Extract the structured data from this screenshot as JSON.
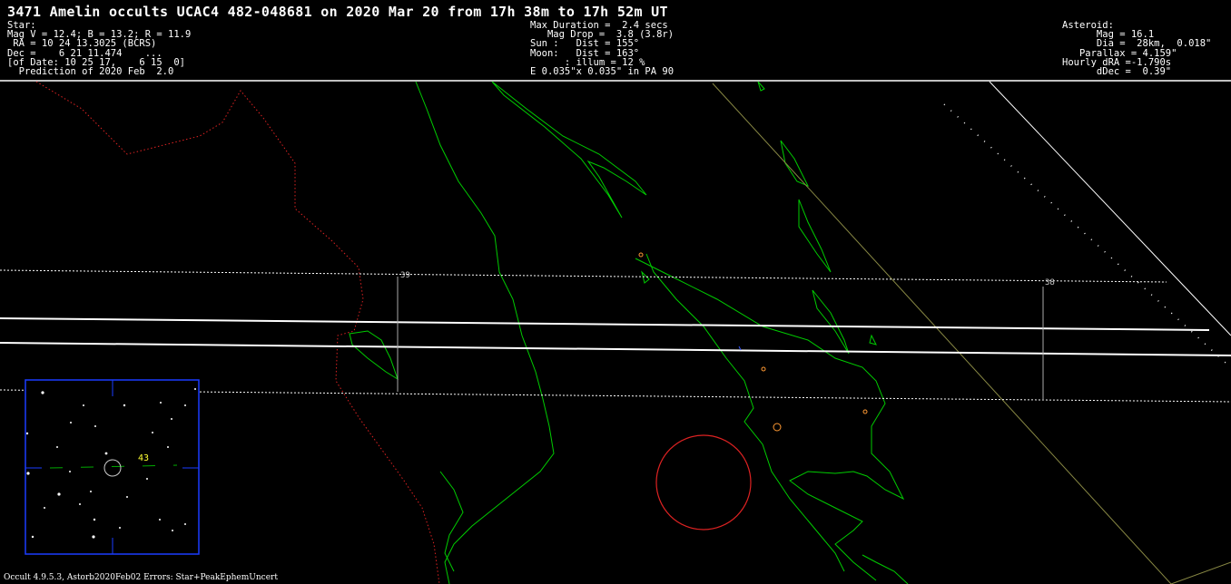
{
  "title": "3471 Amelin occults UCAC4 482-048681 on 2020 Mar 20 from 17h 38m to 17h 52m UT",
  "star_block": {
    "lines": [
      "Star:",
      "Mag V = 12.4; B = 13.2; R = 11.9",
      " RA = 10 24 13.3025 (BCRS)",
      "Dec =    6 21 11.474    ...",
      "[of Date: 10 25 17,    6 15  0]",
      "  Prediction of 2020 Feb  2.0"
    ]
  },
  "event_block": {
    "lines": [
      "Max Duration =  2.4 secs",
      "   Mag Drop =  3.8 (3.8r)",
      "Sun :   Dist = 155°",
      "Moon:   Dist = 163°",
      "      : illum = 12 %",
      "E 0.035\"x 0.035\" in PA 90"
    ]
  },
  "asteroid_block": {
    "lines": [
      "Asteroid:",
      "      Mag = 16.1",
      "      Dia =  28km,  0.018\"",
      "   Parallax = 4.159\"",
      "Hourly dRA =-1.790s",
      "      dDec =  0.39\""
    ]
  },
  "time_marks": {
    "left": "39",
    "right": "38"
  },
  "finder": {
    "star_label": "43"
  },
  "footer": "Occult 4.9.5.3, Astorb2020Feb02  Errors: Star+PeakEphemUncert",
  "colors": {
    "background": "#000000",
    "text": "#ffffff",
    "coastline": "#00dd00",
    "border": "#dd2222",
    "path": "#ffffff",
    "finder_frame": "#1a3cff",
    "site_marker": "#ff9933",
    "label": "#ffff33"
  }
}
